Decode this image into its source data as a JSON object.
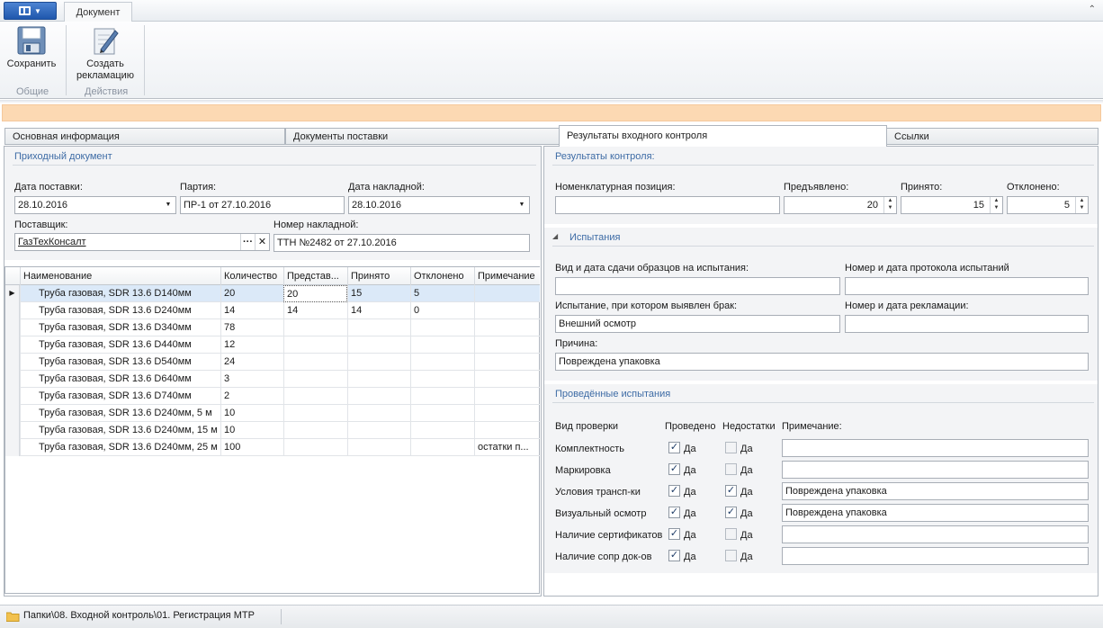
{
  "ribbon": {
    "tab": "Документ",
    "save_label": "Сохранить",
    "complaint_label_1": "Создать",
    "complaint_label_2": "рекламацию",
    "group_general": "Общие",
    "group_actions": "Действия"
  },
  "tabs": [
    "Основная информация",
    "Документы поставки",
    "Результаты входного контроля",
    "Ссылки"
  ],
  "incoming": {
    "title": "Приходный документ",
    "delivery_date_label": "Дата поставки:",
    "delivery_date": "28.10.2016",
    "batch_label": "Партия:",
    "batch": "ПР-1 от 27.10.2016",
    "invoice_date_label": "Дата накладной:",
    "invoice_date": "28.10.2016",
    "supplier_label": "Поставщик:",
    "supplier": "ГазТехКонсалт",
    "invoice_no_label": "Номер накладной:",
    "invoice_no": "ТТН №2482 от 27.10.2016"
  },
  "grid": {
    "columns": [
      "Наименование",
      "Количество",
      "Представ...",
      "Принято",
      "Отклонено",
      "Примечание"
    ],
    "rows": [
      [
        "Труба газовая, SDR 13.6 D140мм",
        "20",
        "20",
        "15",
        "5",
        ""
      ],
      [
        "Труба газовая, SDR 13.6 D240мм",
        "14",
        "14",
        "14",
        "0",
        ""
      ],
      [
        "Труба газовая, SDR 13.6 D340мм",
        "78",
        "",
        "",
        "",
        ""
      ],
      [
        "Труба газовая, SDR 13.6 D440мм",
        "12",
        "",
        "",
        "",
        ""
      ],
      [
        "Труба газовая, SDR 13.6 D540мм",
        "24",
        "",
        "",
        "",
        ""
      ],
      [
        "Труба газовая, SDR 13.6 D640мм",
        "3",
        "",
        "",
        "",
        ""
      ],
      [
        "Труба газовая, SDR 13.6 D740мм",
        "2",
        "",
        "",
        "",
        ""
      ],
      [
        "Труба газовая, SDR 13.6 D240мм, 5 м",
        "10",
        "",
        "",
        "",
        ""
      ],
      [
        "Труба газовая, SDR 13.6 D240мм, 15 м",
        "10",
        "",
        "",
        "",
        ""
      ],
      [
        "Труба газовая, SDR 13.6 D240мм, 25 м",
        "100",
        "",
        "",
        "",
        "остатки п..."
      ]
    ]
  },
  "results": {
    "title": "Результаты контроля:",
    "nomenclature_label": "Номенклатурная позиция:",
    "nomenclature": "",
    "presented_label": "Предъявлено:",
    "presented": "20",
    "accepted_label": "Принято:",
    "accepted": "15",
    "rejected_label": "Отклонено:",
    "rejected": "5"
  },
  "tests": {
    "title": "Испытания",
    "samples_label": "Вид и дата сдачи образцов на испытания:",
    "samples": "",
    "protocol_label": "Номер и дата протокола испытаний",
    "protocol": "",
    "defect_test_label": "Испытание, при котором выявлен брак:",
    "defect_test": "Внешний осмотр",
    "complaint_label": "Номер и дата рекламации:",
    "complaint": "",
    "reason_label": "Причина:",
    "reason": "Повреждена упаковка"
  },
  "done": {
    "title": "Проведённые испытания",
    "col_type": "Вид проверки",
    "col_done": "Проведено",
    "col_defects": "Недостатки",
    "col_note": "Примечание:",
    "yes": "Да",
    "rows": [
      {
        "name": "Комплектность",
        "done": true,
        "defect": false,
        "note": ""
      },
      {
        "name": "Маркировка",
        "done": true,
        "defect": false,
        "note": ""
      },
      {
        "name": "Условия трансп-ки",
        "done": true,
        "defect": true,
        "note": "Повреждена упаковка"
      },
      {
        "name": "Визуальный осмотр",
        "done": true,
        "defect": true,
        "note": "Повреждена упаковка"
      },
      {
        "name": "Наличие сертификатов",
        "done": true,
        "defect": false,
        "note": ""
      },
      {
        "name": "Наличие сопр док-ов",
        "done": true,
        "defect": false,
        "note": ""
      }
    ]
  },
  "status": {
    "path": "Папки\\08. Входной контроль\\01. Регистрация МТР"
  }
}
